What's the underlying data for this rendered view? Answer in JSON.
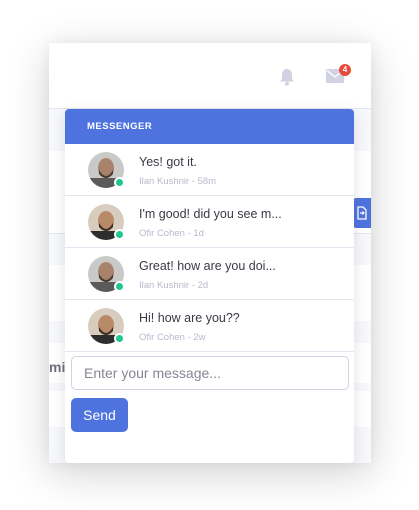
{
  "colors": {
    "primary": "#4e73df",
    "online": "#1cc88a",
    "badge": "#e74a3b",
    "icon_muted": "#d1d3e2"
  },
  "topbar": {
    "bell_icon": "bell-icon",
    "mail_icon": "envelope-icon",
    "mail_badge": "4"
  },
  "background": {
    "partial_label": "mi"
  },
  "messenger": {
    "header": "MESSENGER",
    "messages": [
      {
        "text": "Yes! got it.",
        "meta": "Ilan Kushnir - 58m",
        "status": "online"
      },
      {
        "text": "I'm good! did you see m...",
        "meta": "Ofir Cohen - 1d",
        "status": "online"
      },
      {
        "text": "Great! how are you doi...",
        "meta": "Ilan Kushnir - 2d",
        "status": "online"
      },
      {
        "text": "Hi! how are you??",
        "meta": "Ofir Cohen - 2w",
        "status": "online"
      }
    ],
    "input_placeholder": "Enter your message...",
    "input_value": "",
    "send_label": "Send"
  }
}
